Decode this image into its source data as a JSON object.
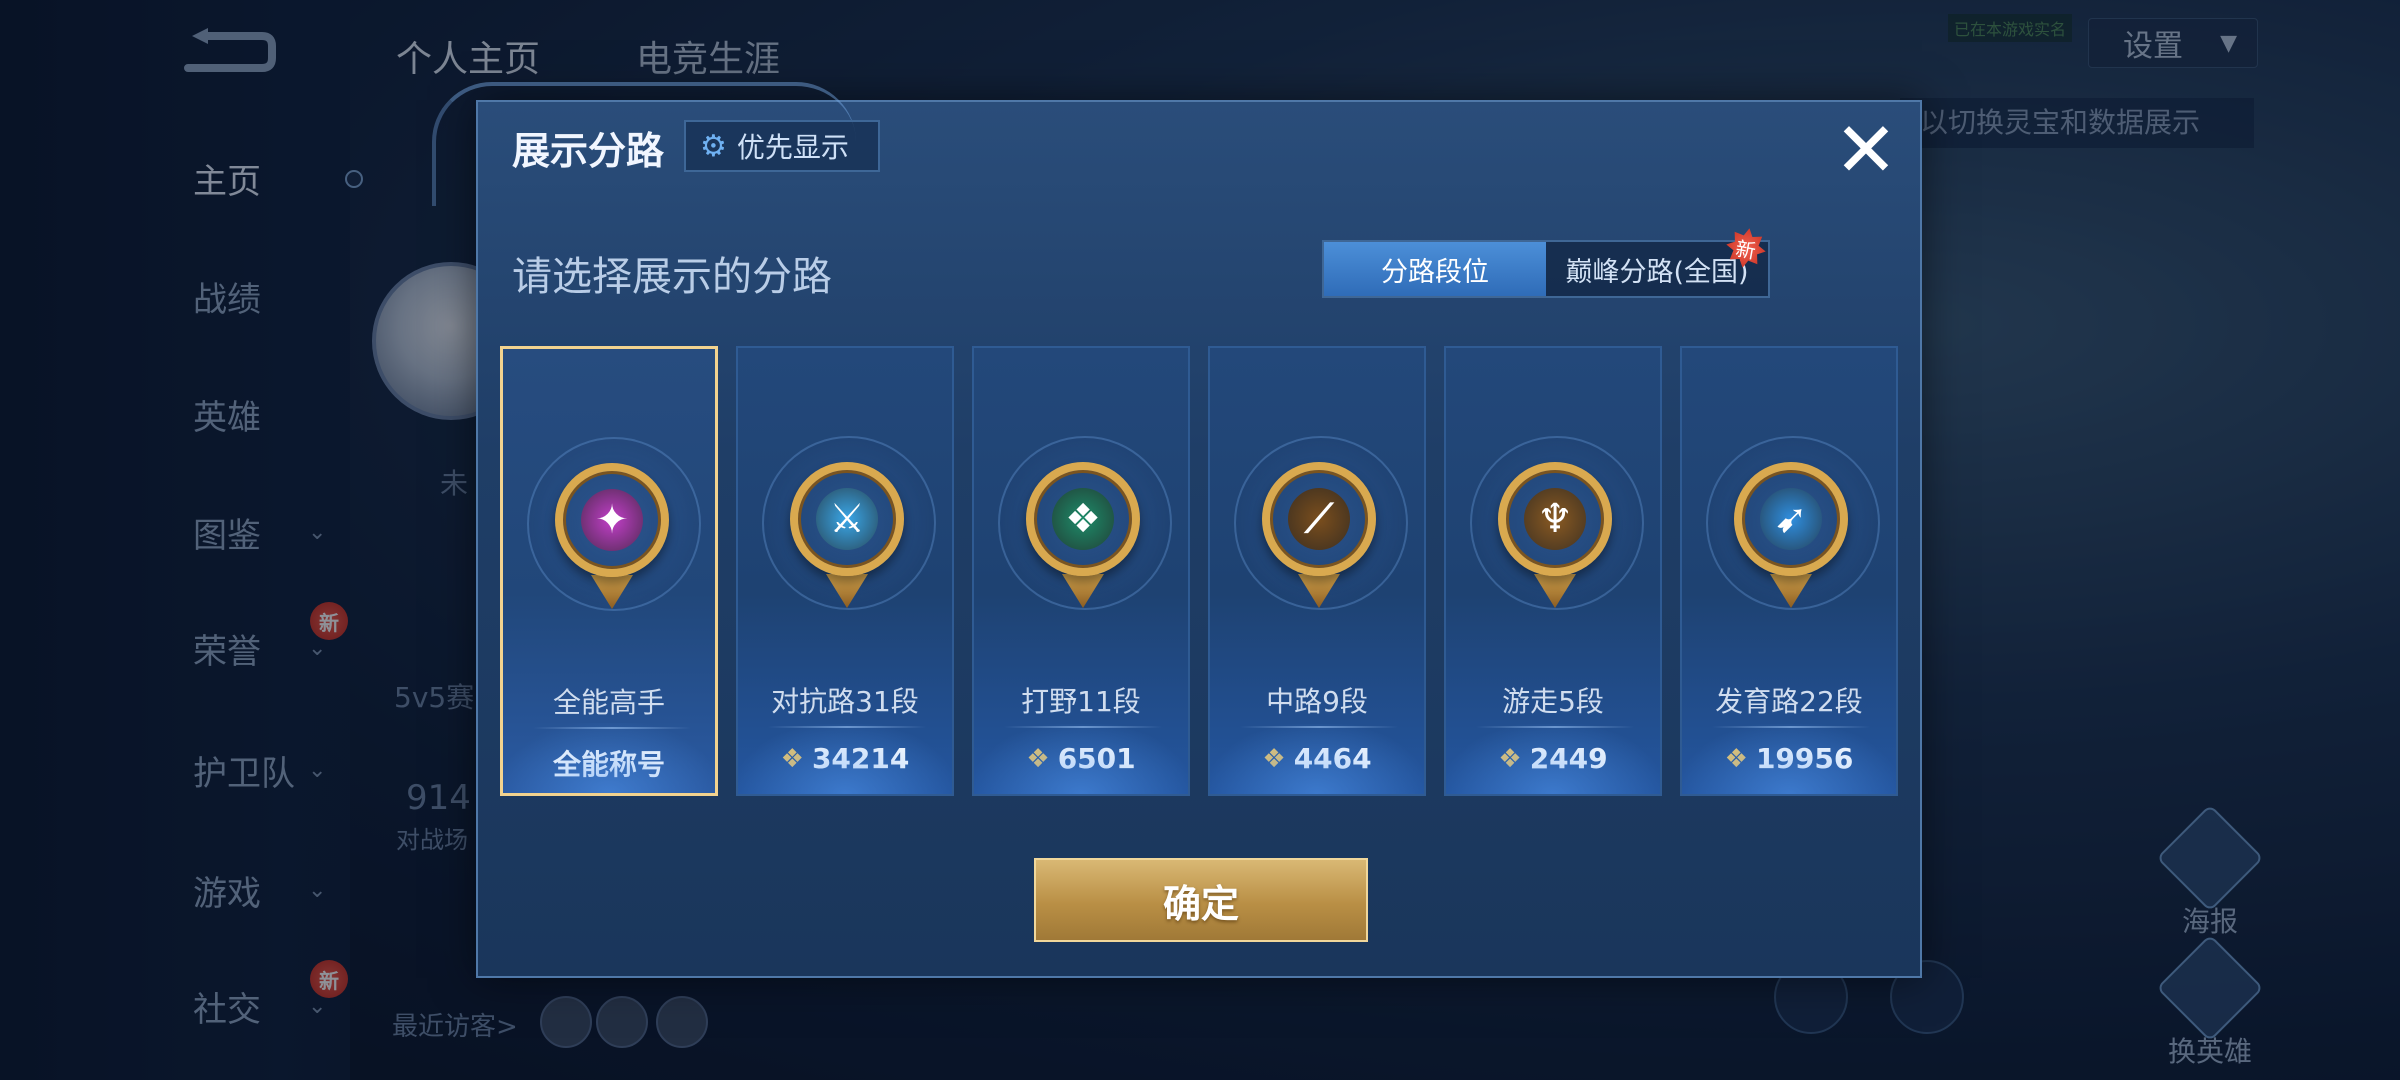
{
  "sidebar": {
    "items": [
      {
        "label": "主页",
        "chevron": false,
        "new": false
      },
      {
        "label": "战绩",
        "chevron": false,
        "new": false
      },
      {
        "label": "英雄",
        "chevron": false,
        "new": false
      },
      {
        "label": "图鉴",
        "chevron": true,
        "new": false
      },
      {
        "label": "荣誉",
        "chevron": true,
        "new": true
      },
      {
        "label": "护卫队",
        "chevron": true,
        "new": false
      },
      {
        "label": "游戏",
        "chevron": true,
        "new": false
      },
      {
        "label": "社交",
        "chevron": true,
        "new": true
      }
    ],
    "active_index": 0,
    "new_badge": "新"
  },
  "header": {
    "tabs": [
      "个人主页",
      "电竞生涯"
    ],
    "settings_label": "设置",
    "hint": "以切换灵宝和数据展示",
    "small_tag": "已在本游戏实名"
  },
  "background": {
    "status_text": "未",
    "mode_text": "5v5赛",
    "match_count": "914",
    "match_label": "对战场",
    "recent_visitors": "最近访客>",
    "right_buttons": [
      "海报",
      "换英雄"
    ]
  },
  "modal": {
    "title": "展示分路",
    "priority_label": "优先显示",
    "close_symbol": "✕",
    "subtitle": "请选择展示的分路",
    "segment_tabs": [
      "分路段位",
      "巅峰分路(全国)"
    ],
    "segment_active": 0,
    "segment_new": "新",
    "confirm_label": "确定",
    "lanes": [
      {
        "name": "全能高手",
        "score": "全能称号",
        "selected": true,
        "emblem_color": "#c23fc9",
        "symbol": "✦",
        "has_score_icon": false
      },
      {
        "name": "对抗路31段",
        "score": "34214",
        "selected": false,
        "emblem_color": "#3aa7e8",
        "symbol": "⚔",
        "has_score_icon": true
      },
      {
        "name": "打野11段",
        "score": "6501",
        "selected": false,
        "emblem_color": "#1e8c6a",
        "symbol": "❖",
        "has_score_icon": true
      },
      {
        "name": "中路9段",
        "score": "4464",
        "selected": false,
        "emblem_color": "#7a4e1d",
        "symbol": "⟋",
        "has_score_icon": true
      },
      {
        "name": "游走5段",
        "score": "2449",
        "selected": false,
        "emblem_color": "#8a5a22",
        "symbol": "♆",
        "has_score_icon": true
      },
      {
        "name": "发育路22段",
        "score": "19956",
        "selected": false,
        "emblem_color": "#2f8fe0",
        "symbol": "➹",
        "has_score_icon": true
      }
    ]
  }
}
